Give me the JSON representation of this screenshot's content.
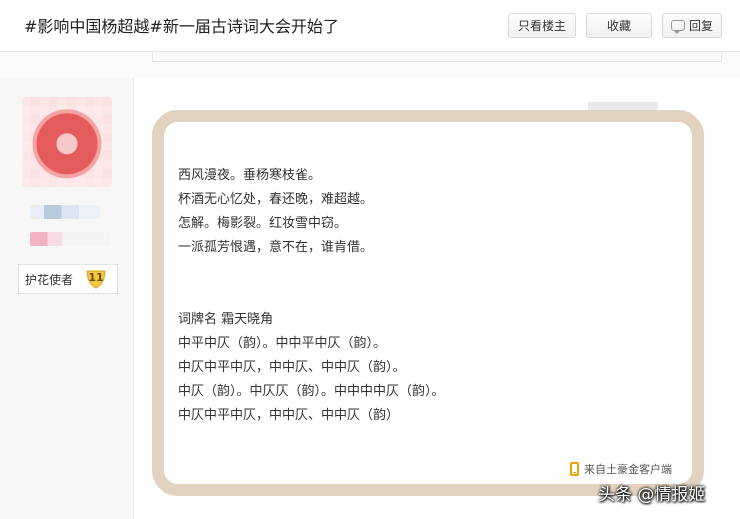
{
  "header": {
    "title": "#影响中国杨超越#新一届古诗词大会开始了",
    "buttons": {
      "only_op": "只看楼主",
      "favorite": "收藏",
      "reply": "回复"
    }
  },
  "author": {
    "badge_label": "护花使者",
    "badge_level": "11"
  },
  "post": {
    "lines_1": [
      "西风漫夜。垂杨寒枝雀。",
      "杯酒无心忆处，春还晚，难超越。",
      "怎解。梅影裂。红妆雪中窃。",
      "一派孤芳恨遇，意不在，谁肯借。"
    ],
    "lines_2": [
      "词牌名 霜天晓角",
      "中平中仄（韵）。中中平中仄（韵）。",
      "中仄中平中仄，中中仄、中中仄（韵）。",
      "中仄（韵）。中仄仄（韵）。中中中中仄（韵）。",
      "中仄中平中仄，中中仄、中中仄（韵）"
    ],
    "source": "来自土豪金客户端"
  },
  "watermark": "头条 @情报姬",
  "icons": {
    "reply": "reply-icon",
    "phone": "phone-icon",
    "level_badge": "shield-badge-icon"
  },
  "colors": {
    "frame": "#e2d3c0",
    "badge_gold": "#f5c842",
    "source_icon": "#f0a000"
  }
}
